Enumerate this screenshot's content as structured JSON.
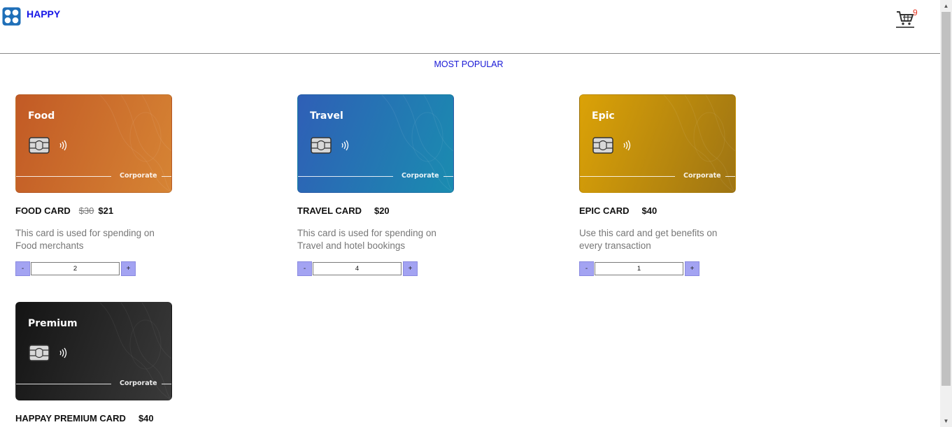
{
  "header": {
    "brand": "HAPPY",
    "cart_count": "9"
  },
  "section_title": "MOST POPULAR",
  "products": [
    {
      "card_label": "Food",
      "card_tag": "Corporate",
      "title": "FOOD CARD",
      "old_price": "$30",
      "price": "$21",
      "description": "This card is used for spending on Food merchants",
      "quantity": "2",
      "minus_label": "-",
      "plus_label": "+",
      "colors": [
        "#c25a25",
        "#d68434"
      ]
    },
    {
      "card_label": "Travel",
      "card_tag": "Corporate",
      "title": "TRAVEL CARD",
      "price": "$20",
      "description": "This card is used for spending on Travel and hotel bookings",
      "quantity": "4",
      "minus_label": "-",
      "plus_label": "+",
      "colors": [
        "#2f5fb6",
        "#1a8cb0"
      ]
    },
    {
      "card_label": "Epic",
      "card_tag": "Corporate",
      "title": "EPIC CARD",
      "price": "$40",
      "description": "Use this card and get benefits on every transaction",
      "quantity": "1",
      "minus_label": "-",
      "plus_label": "+",
      "colors": [
        "#dba207",
        "#9e7413"
      ]
    },
    {
      "card_label": "Premium",
      "card_tag": "Corporate",
      "title": "HAPPAY PREMIUM CARD",
      "price": "$40",
      "colors": [
        "#141414",
        "#3a3a3a"
      ]
    }
  ]
}
